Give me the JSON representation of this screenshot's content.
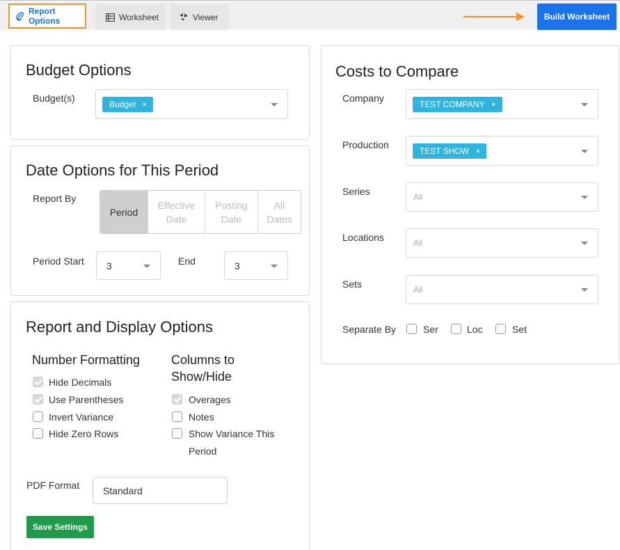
{
  "tabs": [
    {
      "label": "Report Options",
      "icon": "paperclip-icon",
      "active": true
    },
    {
      "label": "Worksheet",
      "icon": "table-icon",
      "active": false
    },
    {
      "label": "Viewer",
      "icon": "viewer-icon",
      "active": false
    }
  ],
  "toolbar": {
    "build_label": "Build Worksheet"
  },
  "budget": {
    "title": "Budget Options",
    "budgets_label": "Budget(s)",
    "chip": "Budget",
    "chip_remove": "×"
  },
  "date": {
    "title": "Date Options for This Period",
    "report_by_label": "Report By",
    "segments": [
      "Period",
      "Effective Date",
      "Posting Date",
      "All Dates"
    ],
    "period_start_label": "Period Start",
    "period_start_value": "3",
    "end_label": "End",
    "end_value": "3"
  },
  "display": {
    "title": "Report and Display Options",
    "number_formatting": {
      "title": "Number Formatting",
      "items": [
        {
          "label": "Hide Decimals",
          "checked": true
        },
        {
          "label": "Use Parentheses",
          "checked": true
        },
        {
          "label": "Invert Variance",
          "checked": false
        },
        {
          "label": "Hide Zero Rows",
          "checked": false
        }
      ]
    },
    "columns": {
      "title_line1": "Columns to",
      "title_line2": "Show/Hide",
      "items": [
        {
          "label": "Overages",
          "checked": true
        },
        {
          "label": "Notes",
          "checked": false
        },
        {
          "label": "Show Variance This",
          "label2": "Period",
          "checked": false
        }
      ]
    },
    "pdf_label": "PDF Format",
    "pdf_value": "Standard",
    "save_label": "Save Settings"
  },
  "costs": {
    "title": "Costs to Compare",
    "company_label": "Company",
    "company_chip": "TEST COMPANY",
    "production_label": "Production",
    "production_chip": "TEST SHOW",
    "chip_remove": "×",
    "series_label": "Series",
    "series_placeholder": "All",
    "locations_label": "Locations",
    "locations_placeholder": "All",
    "sets_label": "Sets",
    "sets_placeholder": "All",
    "separate_by_label": "Separate By",
    "separate_options": [
      "Ser",
      "Loc",
      "Set"
    ]
  },
  "colors": {
    "accent_orange": "#f0932d",
    "primary_blue": "#1a73e8",
    "chip_cyan": "#2fb4dd",
    "save_green": "#1f9b4a"
  }
}
